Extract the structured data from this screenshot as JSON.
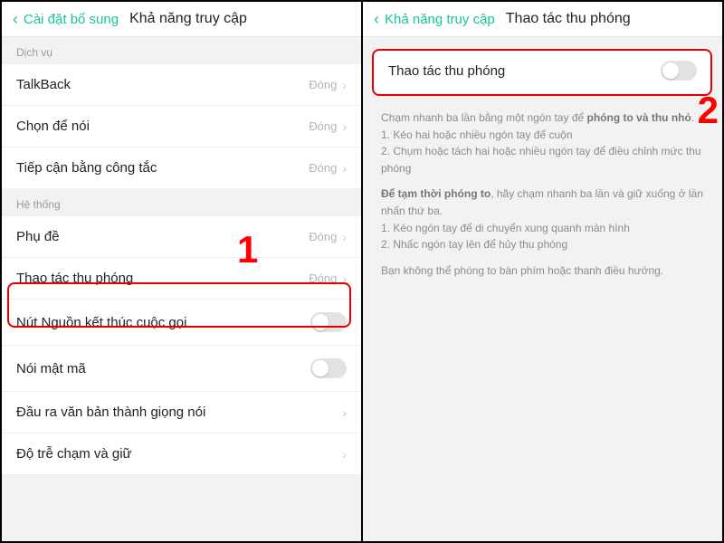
{
  "left": {
    "back": "Cài đặt bổ sung",
    "title": "Khả năng truy cập",
    "section1": "Dịch vụ",
    "rows1": [
      {
        "label": "TalkBack",
        "status": "Đóng"
      },
      {
        "label": "Chọn để nói",
        "status": "Đóng"
      },
      {
        "label": "Tiếp cận bằng công tắc",
        "status": "Đóng"
      }
    ],
    "section2": "Hệ thống",
    "rows2a": [
      {
        "label": "Phụ đề",
        "status": "Đóng"
      },
      {
        "label": "Thao tác thu phóng",
        "status": "Đóng"
      }
    ],
    "rows2b": [
      {
        "label": "Nút Nguồn kết thúc cuộc gọi"
      },
      {
        "label": "Nói mật mã"
      }
    ],
    "rows2c": [
      {
        "label": "Đầu ra văn bản thành giọng nói"
      },
      {
        "label": "Độ trễ chạm và giữ"
      }
    ],
    "annotation": "1"
  },
  "right": {
    "back": "Khả năng truy cập",
    "title": "Thao tác thu phóng",
    "cardLabel": "Thao tác thu phóng",
    "desc": {
      "p1a": "Chạm nhanh ba lần bằng một ngón tay để ",
      "p1bold": "phóng to và thu nhỏ",
      "p1b": ".",
      "l1": "1. Kéo hai hoặc nhiều ngón tay để cuộn",
      "l2": "2. Chụm hoặc tách hai hoặc nhiều ngón tay để điều chỉnh mức thu phóng",
      "p2a": "Để tạm thời phóng to",
      "p2b": ", hãy chạm nhanh ba lần và giữ xuống ở lần nhấn thứ ba.",
      "l3": "1. Kéo ngón tay để di chuyển xung quanh màn hình",
      "l4": "2. Nhấc ngón tay lên để hủy thu phóng",
      "p3": "Bạn không thể phóng to bàn phím hoặc thanh điều hướng."
    },
    "annotation": "2"
  }
}
